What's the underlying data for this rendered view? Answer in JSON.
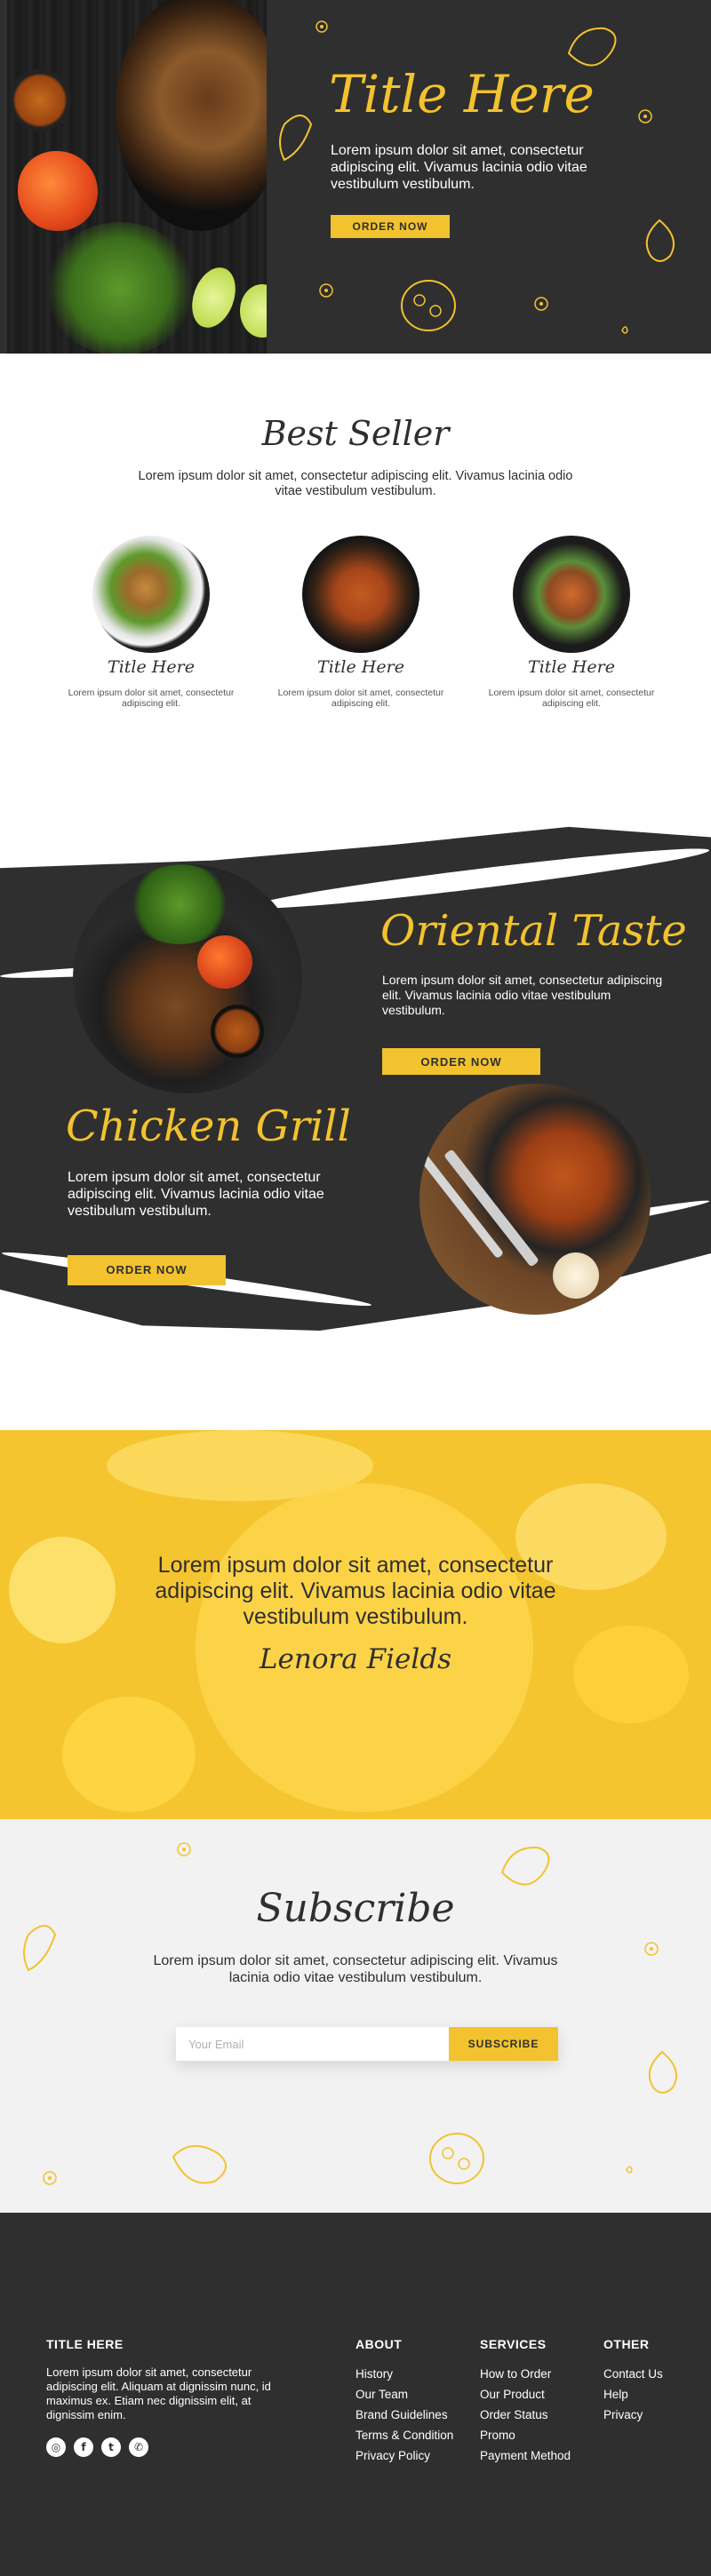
{
  "hero": {
    "title": "Title Here",
    "text": "Lorem ipsum dolor sit amet, consectetur adipiscing elit. Vivamus lacinia odio vitae vestibulum vestibulum.",
    "button": "ORDER NOW"
  },
  "best_seller": {
    "title": "Best Seller",
    "text": "Lorem ipsum dolor sit amet, consectetur adipiscing elit. Vivamus lacinia odio vitae vestibulum vestibulum.",
    "items": [
      {
        "title": "Title Here",
        "desc": "Lorem ipsum dolor sit amet, consectetur adipiscing elit."
      },
      {
        "title": "Title Here",
        "desc": "Lorem ipsum dolor sit amet, consectetur adipiscing elit."
      },
      {
        "title": "Title Here",
        "desc": "Lorem ipsum dolor sit amet, consectetur adipiscing elit."
      }
    ]
  },
  "features": [
    {
      "title": "Oriental Taste",
      "text": "Lorem ipsum dolor sit amet, consectetur adipiscing elit. Vivamus lacinia odio vitae vestibulum vestibulum.",
      "button": "ORDER NOW"
    },
    {
      "title": "Chicken Grill",
      "text": "Lorem ipsum dolor sit amet, consectetur adipiscing elit. Vivamus lacinia odio vitae vestibulum vestibulum.",
      "button": "ORDER NOW"
    }
  ],
  "testimonial": {
    "quote": "Lorem ipsum dolor sit amet, consectetur adipiscing elit. Vivamus lacinia odio vitae vestibulum vestibulum.",
    "name": "Lenora Fields"
  },
  "subscribe": {
    "title": "Subscribe",
    "text": "Lorem ipsum dolor sit amet, consectetur adipiscing elit. Vivamus lacinia odio vitae vestibulum vestibulum.",
    "placeholder": "Your Email",
    "button": "SUBSCRIBE"
  },
  "footer": {
    "brand_title": "TITLE HERE",
    "brand_text": "Lorem ipsum dolor sit amet, consectetur adipiscing elit. Aliquam at dignissim nunc, id maximus ex. Etiam nec dignissim elit, at dignissim enim.",
    "social_icons": [
      "instagram-icon",
      "facebook-icon",
      "twitter-icon",
      "whatsapp-icon"
    ],
    "columns": [
      {
        "title": "ABOUT",
        "links": [
          "History",
          "Our Team",
          "Brand Guidelines",
          "Terms & Condition",
          "Privacy Policy"
        ]
      },
      {
        "title": "SERVICES",
        "links": [
          "How to Order",
          "Our Product",
          "Order Status",
          "Promo",
          "Payment Method"
        ]
      },
      {
        "title": "OTHER",
        "links": [
          "Contact Us",
          "Help",
          "Privacy"
        ]
      }
    ]
  },
  "colors": {
    "accent": "#f2c22f",
    "dark": "#2f2f2f",
    "light_bg": "#f2f2f2"
  }
}
